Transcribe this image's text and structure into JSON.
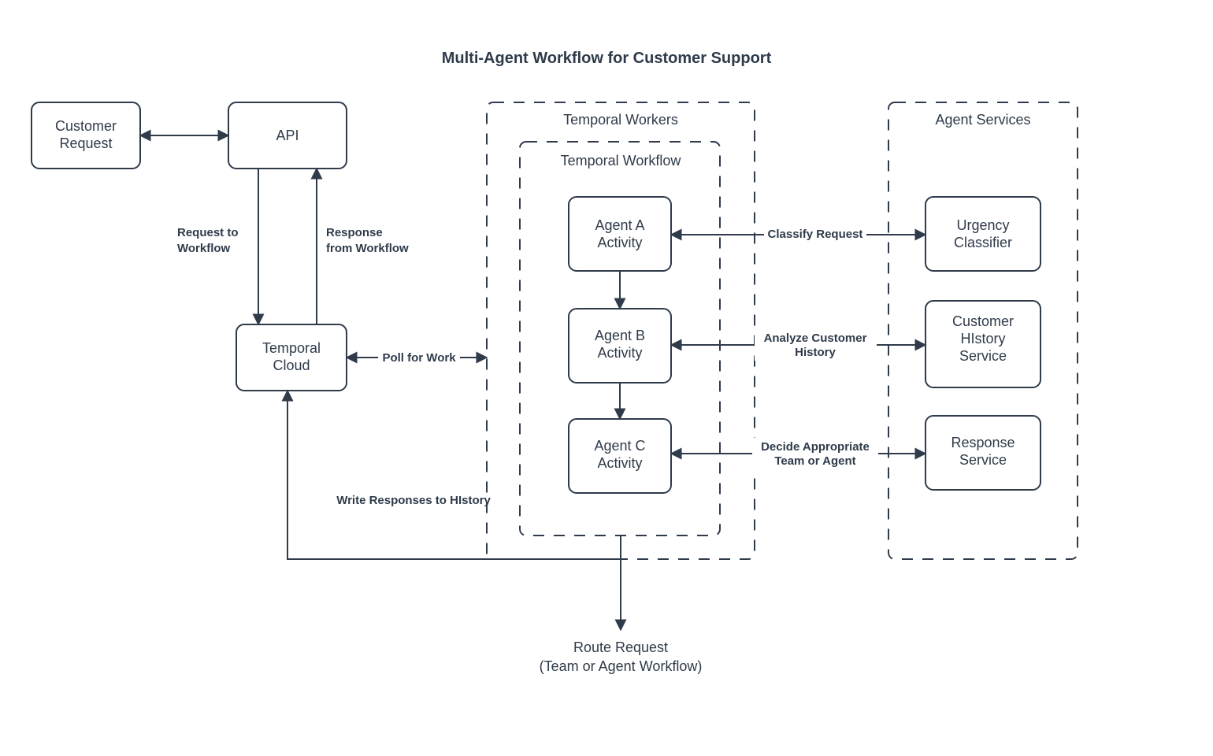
{
  "title": "Multi-Agent Workflow for Customer Support",
  "nodes": {
    "customer_request": "Customer Request",
    "api": "API",
    "temporal_cloud": "Temporal Cloud",
    "agent_a": "Agent A Activity",
    "agent_b": "Agent B Activity",
    "agent_c": "Agent C Activity",
    "urgency_classifier": "Urgency Classifier",
    "history_service_l1": "Customer",
    "history_service_l2": "HIstory",
    "history_service_l3": "Service",
    "response_service": "Response Service"
  },
  "groups": {
    "workers": "Temporal Workers",
    "workflow": "Temporal Workflow",
    "agents": "Agent Services"
  },
  "edges": {
    "req_to_wf_l1": "Request to",
    "req_to_wf_l2": "Workflow",
    "resp_from_wf_l1": "Response",
    "resp_from_wf_l2": "from Workflow",
    "poll": "Poll for Work",
    "write_history": "Write Responses to HIstory",
    "classify": "Classify Request",
    "analyze_l1": "Analyze Customer",
    "analyze_l2": "History",
    "decide_l1": "Decide Appropriate",
    "decide_l2": "Team or Agent",
    "route_l1": "Route Request",
    "route_l2": "(Team or Agent Workflow)"
  }
}
